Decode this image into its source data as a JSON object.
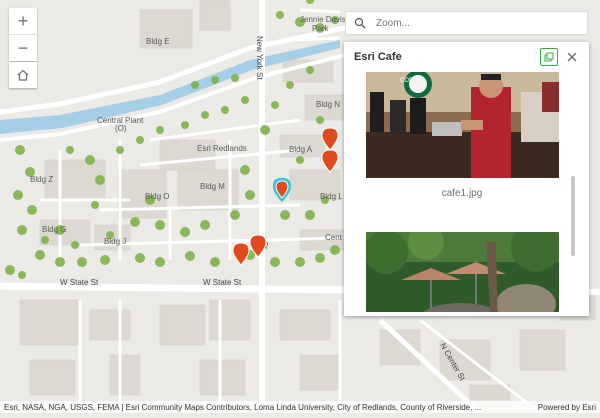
{
  "map": {
    "labels": {
      "jennie_davis_park_1": "Jennie Davis",
      "jennie_davis_park_2": "Park",
      "bldg_e": "Bldg E",
      "central_plant_1": "Central Plant",
      "central_plant_2": "(O)",
      "esri_redlands": "Esri Redlands",
      "bldg_n": "Bldg N",
      "bldg_a": "Bldg A",
      "bldg_z": "Bldg Z",
      "bldg_m": "Bldg M",
      "bldg_o": "Bldg O",
      "bldg_l": "Bldg L",
      "bldg_g": "Bldg G",
      "bldg_j": "Bldg J",
      "bldg_q": "Q",
      "cent": "Cent",
      "w_state_st_left": "W State St",
      "w_state_st_mid": "W State St",
      "new_york_st": "New York St",
      "n_center_st": "N Center St"
    },
    "markers": [
      {
        "name": "marker-1",
        "color": "#e04a1f"
      },
      {
        "name": "marker-2",
        "color": "#e04a1f"
      },
      {
        "name": "marker-selected",
        "color": "#e04a1f",
        "highlight": "#2fc6d8"
      },
      {
        "name": "marker-3",
        "color": "#e04a1f"
      },
      {
        "name": "marker-4",
        "color": "#e04a1f"
      }
    ]
  },
  "controls": {
    "zoom_in": "+",
    "zoom_out": "−",
    "home_icon": "home-icon"
  },
  "search": {
    "placeholder": "Zoom..."
  },
  "popup": {
    "title": "Esri Cafe",
    "dock_icon": "dock-icon",
    "close_icon": "close-icon",
    "photo1_caption": "cafe1.jpg",
    "photo1_sign": "COFFE"
  },
  "attribution": {
    "text": "Esri, NASA, NGA, USGS, FEMA | Esri Community Maps Contributors, Loma Linda University, City of Redlands, County of Riverside, ...",
    "powered_by": "Powered by Esri"
  },
  "colors": {
    "map_bg": "#eceae6",
    "road": "#ffffff",
    "building": "#dcd9d3",
    "tree": "#7fb24a",
    "water": "#a5cfe6",
    "accent": "#35ac46"
  }
}
